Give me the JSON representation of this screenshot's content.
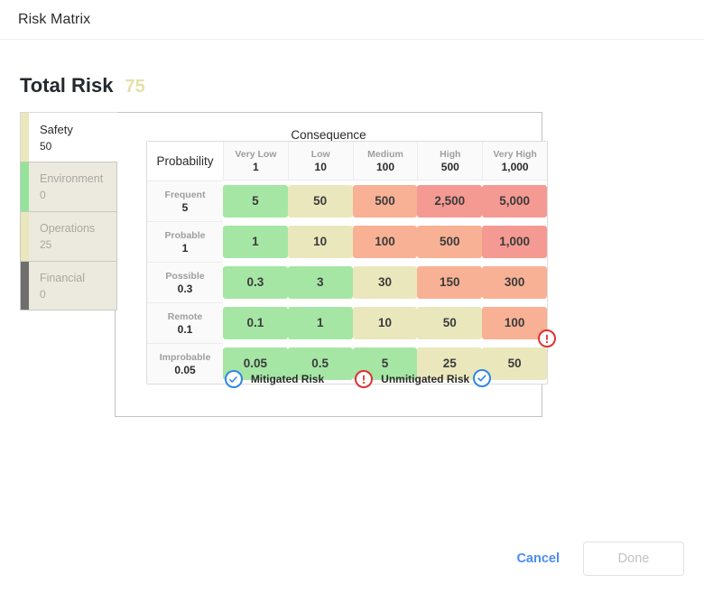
{
  "window": {
    "title": "Risk Matrix"
  },
  "summary": {
    "label": "Total Risk",
    "value": "75",
    "value_color": "#e6e0a8"
  },
  "categories": [
    {
      "name": "Safety",
      "value": "50",
      "bar_color": "#eae7bc",
      "selected": true
    },
    {
      "name": "Environment",
      "value": "0",
      "bar_color": "#93e39b",
      "selected": false
    },
    {
      "name": "Operations",
      "value": "25",
      "bar_color": "#eae7bc",
      "selected": false
    },
    {
      "name": "Financial",
      "value": "0",
      "bar_color": "#6e6e6e",
      "selected": false
    }
  ],
  "matrix": {
    "consequence_caption": "Consequence",
    "probability_caption": "Probability",
    "columns": [
      {
        "name": "Very Low",
        "value": "1"
      },
      {
        "name": "Low",
        "value": "10"
      },
      {
        "name": "Medium",
        "value": "100"
      },
      {
        "name": "High",
        "value": "500"
      },
      {
        "name": "Very High",
        "value": "1,000"
      }
    ],
    "rows": [
      {
        "name": "Frequent",
        "value": "5"
      },
      {
        "name": "Probable",
        "value": "1"
      },
      {
        "name": "Possible",
        "value": "0.3"
      },
      {
        "name": "Remote",
        "value": "0.1"
      },
      {
        "name": "Improbable",
        "value": "0.05"
      }
    ],
    "cells": [
      [
        {
          "text": "5",
          "level": "low"
        },
        {
          "text": "50",
          "level": "medium"
        },
        {
          "text": "500",
          "level": "high"
        },
        {
          "text": "2,500",
          "level": "critical"
        },
        {
          "text": "5,000",
          "level": "critical"
        }
      ],
      [
        {
          "text": "1",
          "level": "low"
        },
        {
          "text": "10",
          "level": "medium"
        },
        {
          "text": "100",
          "level": "high"
        },
        {
          "text": "500",
          "level": "high"
        },
        {
          "text": "1,000",
          "level": "critical"
        }
      ],
      [
        {
          "text": "0.3",
          "level": "low"
        },
        {
          "text": "3",
          "level": "low"
        },
        {
          "text": "30",
          "level": "medium"
        },
        {
          "text": "150",
          "level": "high"
        },
        {
          "text": "300",
          "level": "high"
        }
      ],
      [
        {
          "text": "0.1",
          "level": "low"
        },
        {
          "text": "1",
          "level": "low"
        },
        {
          "text": "10",
          "level": "medium"
        },
        {
          "text": "50",
          "level": "medium"
        },
        {
          "text": "100",
          "level": "high"
        }
      ],
      [
        {
          "text": "0.05",
          "level": "low"
        },
        {
          "text": "0.5",
          "level": "low"
        },
        {
          "text": "5",
          "level": "low"
        },
        {
          "text": "25",
          "level": "medium"
        },
        {
          "text": "50",
          "level": "medium",
          "mitigated_marker": true,
          "unmitigated_marker": true
        }
      ]
    ],
    "level_colors": {
      "low": "#a5e6a5",
      "medium": "#eae7bc",
      "high": "#f8b195",
      "critical": "#f59a92"
    }
  },
  "legend": [
    {
      "label": "Mitigated Risk",
      "icon": "check-circle-icon",
      "color": "#2f86e8"
    },
    {
      "label": "Unmitigated Risk",
      "icon": "exclamation-circle-icon",
      "color": "#e03131"
    }
  ],
  "footer": {
    "cancel_label": "Cancel",
    "done_label": "Done"
  }
}
